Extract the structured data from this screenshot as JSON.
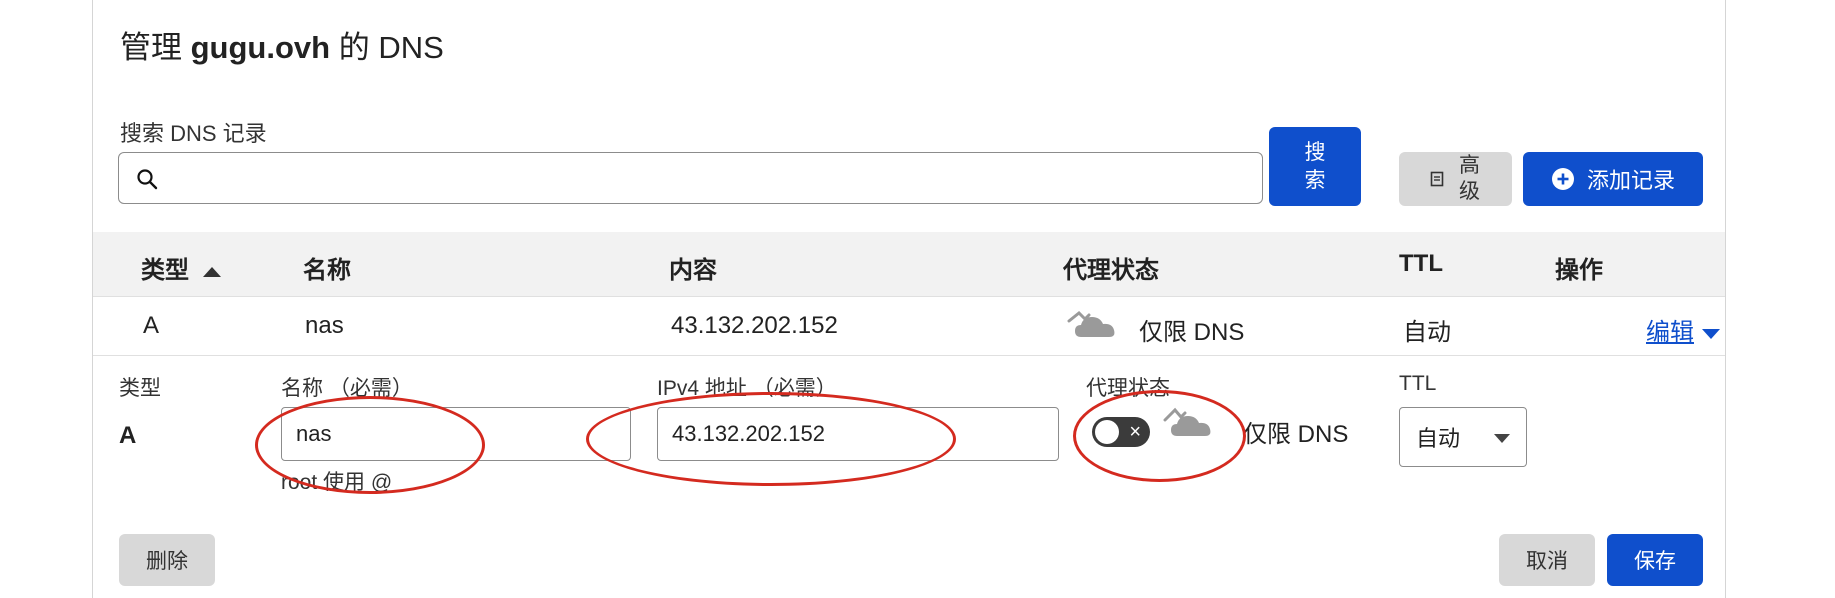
{
  "title": {
    "prefix": "管理 ",
    "domain": "gugu.ovh",
    "suffix": " 的 DNS"
  },
  "search": {
    "label": "搜索 DNS 记录",
    "value": "",
    "button_label": "搜\n索"
  },
  "toolbar": {
    "advanced_label": "高\n级",
    "add_record_label": "添加记录"
  },
  "table": {
    "headers": {
      "type": "类型",
      "name": "名称",
      "content": "内容",
      "proxy": "代理状态",
      "ttl": "TTL",
      "actions": "操作"
    },
    "row": {
      "type": "A",
      "name": "nas",
      "content": "43.132.202.152",
      "proxy": "仅限 DNS",
      "ttl": "自动",
      "action": "编辑"
    }
  },
  "edit_form": {
    "type_label": "类型",
    "type_value": "A",
    "name_label": "名称 （必需）",
    "name_value": "nas",
    "name_hint": "root 使用 @",
    "ipv4_label": "IPv4 地址 （必需）",
    "ipv4_value": "43.132.202.152",
    "proxy_label": "代理状态",
    "proxy_value": "仅限 DNS",
    "ttl_label": "TTL",
    "ttl_value": "自动",
    "delete_label": "删除",
    "cancel_label": "取消",
    "save_label": "保存"
  },
  "colors": {
    "primary": "#0f4fcc",
    "annotation": "#d42a1f",
    "secondary_button": "#d8d8d8"
  }
}
